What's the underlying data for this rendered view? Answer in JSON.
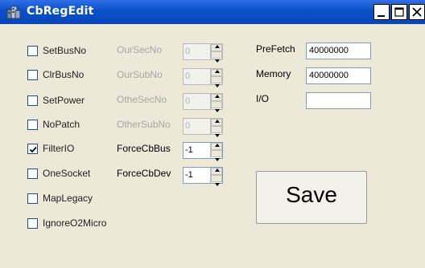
{
  "window": {
    "title": "CbRegEdit"
  },
  "titlebar_icons": {
    "app": "registry-app-icon",
    "minimize": "minimize-icon",
    "maximize": "maximize-icon",
    "close": "close-icon"
  },
  "checkboxes": {
    "setbusno": {
      "label": "SetBusNo",
      "checked": false
    },
    "clrbusno": {
      "label": "ClrBusNo",
      "checked": false
    },
    "setpower": {
      "label": "SetPower",
      "checked": false
    },
    "nopatch": {
      "label": "NoPatch",
      "checked": false
    },
    "filterio": {
      "label": "FilterIO",
      "checked": true
    },
    "onesocket": {
      "label": "OneSocket",
      "checked": false
    },
    "maplegacy": {
      "label": "MapLegacy",
      "checked": false
    },
    "ignoreo2micro": {
      "label": "IgnoreO2Micro",
      "checked": false
    }
  },
  "fields": {
    "oursecno": {
      "label": "OurSecNo",
      "value": "0",
      "enabled": false
    },
    "oursubno": {
      "label": "OurSubNo",
      "value": "0",
      "enabled": false
    },
    "othesecno": {
      "label": "OtheSecNo",
      "value": "0",
      "enabled": false
    },
    "othersubno": {
      "label": "OtherSubNo",
      "value": "0",
      "enabled": false
    },
    "forcecbbus": {
      "label": "ForceCbBus",
      "value": "-1",
      "enabled": true
    },
    "forcecbdev": {
      "label": "ForceCbDev",
      "value": "-1",
      "enabled": true
    }
  },
  "resources": {
    "prefetch": {
      "label": "PreFetch",
      "value": "40000000"
    },
    "memory": {
      "label": "Memory",
      "value": "40000000"
    },
    "io": {
      "label": "I/O",
      "value": ""
    }
  },
  "save_button": {
    "label": "Save"
  }
}
